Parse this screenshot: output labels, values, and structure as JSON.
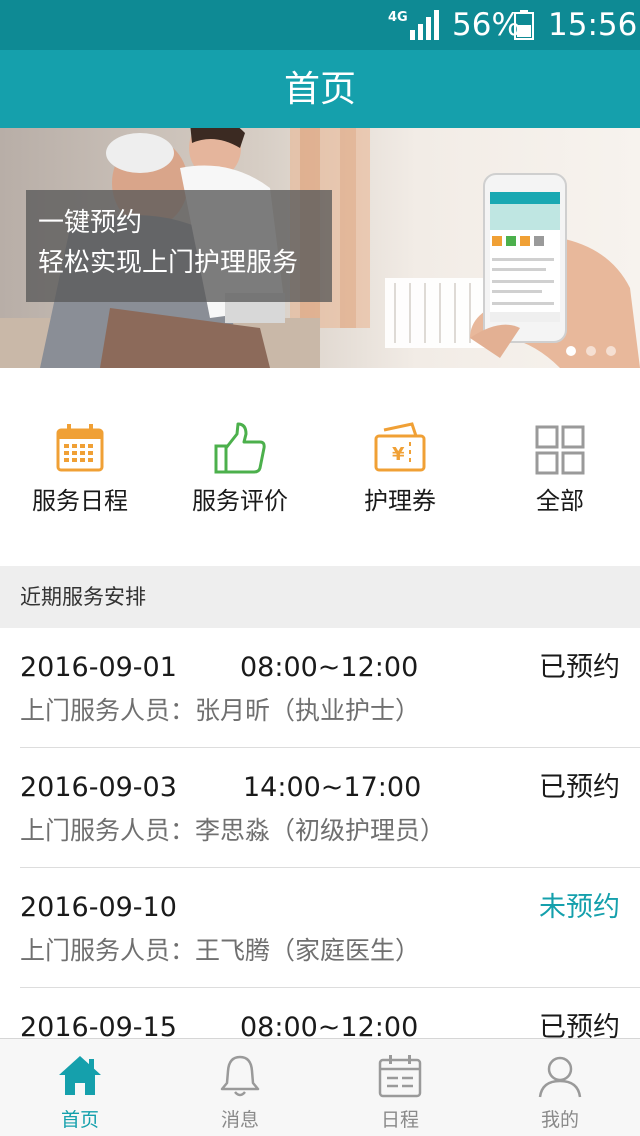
{
  "status_bar": {
    "network": "4G",
    "battery": "56%",
    "time": "15:56"
  },
  "nav": {
    "title": "首页"
  },
  "banner": {
    "line1": "一键预约",
    "line2": "轻松实现上门护理服务"
  },
  "quick_actions": [
    {
      "label": "服务日程",
      "icon": "calendar-icon",
      "color": "#f0a035"
    },
    {
      "label": "服务评价",
      "icon": "thumbs-up-icon",
      "color": "#4cb04c"
    },
    {
      "label": "护理券",
      "icon": "voucher-icon",
      "color": "#f0a035"
    },
    {
      "label": "全部",
      "icon": "grid-icon",
      "color": "#9a9a9a"
    }
  ],
  "section": {
    "title": "近期服务安排"
  },
  "schedule": [
    {
      "date": "2016-09-01",
      "time": "08:00~12:00",
      "status": "已预约",
      "staff": "上门服务人员：张月昕（执业护士）"
    },
    {
      "date": "2016-09-03",
      "time": "14:00~17:00",
      "status": "已预约",
      "staff": "上门服务人员：李思淼（初级护理员）"
    },
    {
      "date": "2016-09-10",
      "time": "",
      "status": "未预约",
      "staff": "上门服务人员：王飞腾（家庭医生）"
    },
    {
      "date": "2016-09-15",
      "time": "08:00~12:00",
      "status": "已预约",
      "staff": ""
    }
  ],
  "tabs": [
    {
      "label": "首页",
      "icon": "home-icon",
      "active": true
    },
    {
      "label": "消息",
      "icon": "bell-icon",
      "active": false
    },
    {
      "label": "日程",
      "icon": "calendar-icon",
      "active": false
    },
    {
      "label": "我的",
      "icon": "user-icon",
      "active": false
    }
  ],
  "colors": {
    "brand": "#15a0ac",
    "status_pending": "#15a0ac",
    "icon_orange": "#f0a035",
    "icon_green": "#4cb04c"
  }
}
